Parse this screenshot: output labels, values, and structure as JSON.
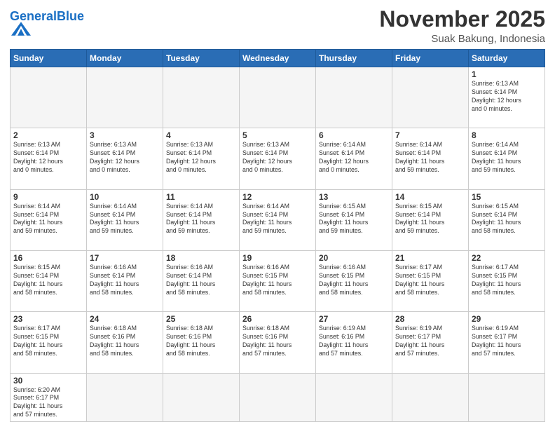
{
  "header": {
    "logo_general": "General",
    "logo_blue": "Blue",
    "month": "November 2025",
    "location": "Suak Bakung, Indonesia"
  },
  "days_of_week": [
    "Sunday",
    "Monday",
    "Tuesday",
    "Wednesday",
    "Thursday",
    "Friday",
    "Saturday"
  ],
  "weeks": [
    [
      {
        "day": "",
        "info": ""
      },
      {
        "day": "",
        "info": ""
      },
      {
        "day": "",
        "info": ""
      },
      {
        "day": "",
        "info": ""
      },
      {
        "day": "",
        "info": ""
      },
      {
        "day": "",
        "info": ""
      },
      {
        "day": "1",
        "info": "Sunrise: 6:13 AM\nSunset: 6:14 PM\nDaylight: 12 hours\nand 0 minutes."
      }
    ],
    [
      {
        "day": "2",
        "info": "Sunrise: 6:13 AM\nSunset: 6:14 PM\nDaylight: 12 hours\nand 0 minutes."
      },
      {
        "day": "3",
        "info": "Sunrise: 6:13 AM\nSunset: 6:14 PM\nDaylight: 12 hours\nand 0 minutes."
      },
      {
        "day": "4",
        "info": "Sunrise: 6:13 AM\nSunset: 6:14 PM\nDaylight: 12 hours\nand 0 minutes."
      },
      {
        "day": "5",
        "info": "Sunrise: 6:13 AM\nSunset: 6:14 PM\nDaylight: 12 hours\nand 0 minutes."
      },
      {
        "day": "6",
        "info": "Sunrise: 6:14 AM\nSunset: 6:14 PM\nDaylight: 12 hours\nand 0 minutes."
      },
      {
        "day": "7",
        "info": "Sunrise: 6:14 AM\nSunset: 6:14 PM\nDaylight: 11 hours\nand 59 minutes."
      },
      {
        "day": "8",
        "info": "Sunrise: 6:14 AM\nSunset: 6:14 PM\nDaylight: 11 hours\nand 59 minutes."
      }
    ],
    [
      {
        "day": "9",
        "info": "Sunrise: 6:14 AM\nSunset: 6:14 PM\nDaylight: 11 hours\nand 59 minutes."
      },
      {
        "day": "10",
        "info": "Sunrise: 6:14 AM\nSunset: 6:14 PM\nDaylight: 11 hours\nand 59 minutes."
      },
      {
        "day": "11",
        "info": "Sunrise: 6:14 AM\nSunset: 6:14 PM\nDaylight: 11 hours\nand 59 minutes."
      },
      {
        "day": "12",
        "info": "Sunrise: 6:14 AM\nSunset: 6:14 PM\nDaylight: 11 hours\nand 59 minutes."
      },
      {
        "day": "13",
        "info": "Sunrise: 6:15 AM\nSunset: 6:14 PM\nDaylight: 11 hours\nand 59 minutes."
      },
      {
        "day": "14",
        "info": "Sunrise: 6:15 AM\nSunset: 6:14 PM\nDaylight: 11 hours\nand 59 minutes."
      },
      {
        "day": "15",
        "info": "Sunrise: 6:15 AM\nSunset: 6:14 PM\nDaylight: 11 hours\nand 58 minutes."
      }
    ],
    [
      {
        "day": "16",
        "info": "Sunrise: 6:15 AM\nSunset: 6:14 PM\nDaylight: 11 hours\nand 58 minutes."
      },
      {
        "day": "17",
        "info": "Sunrise: 6:16 AM\nSunset: 6:14 PM\nDaylight: 11 hours\nand 58 minutes."
      },
      {
        "day": "18",
        "info": "Sunrise: 6:16 AM\nSunset: 6:14 PM\nDaylight: 11 hours\nand 58 minutes."
      },
      {
        "day": "19",
        "info": "Sunrise: 6:16 AM\nSunset: 6:15 PM\nDaylight: 11 hours\nand 58 minutes."
      },
      {
        "day": "20",
        "info": "Sunrise: 6:16 AM\nSunset: 6:15 PM\nDaylight: 11 hours\nand 58 minutes."
      },
      {
        "day": "21",
        "info": "Sunrise: 6:17 AM\nSunset: 6:15 PM\nDaylight: 11 hours\nand 58 minutes."
      },
      {
        "day": "22",
        "info": "Sunrise: 6:17 AM\nSunset: 6:15 PM\nDaylight: 11 hours\nand 58 minutes."
      }
    ],
    [
      {
        "day": "23",
        "info": "Sunrise: 6:17 AM\nSunset: 6:15 PM\nDaylight: 11 hours\nand 58 minutes."
      },
      {
        "day": "24",
        "info": "Sunrise: 6:18 AM\nSunset: 6:16 PM\nDaylight: 11 hours\nand 58 minutes."
      },
      {
        "day": "25",
        "info": "Sunrise: 6:18 AM\nSunset: 6:16 PM\nDaylight: 11 hours\nand 58 minutes."
      },
      {
        "day": "26",
        "info": "Sunrise: 6:18 AM\nSunset: 6:16 PM\nDaylight: 11 hours\nand 57 minutes."
      },
      {
        "day": "27",
        "info": "Sunrise: 6:19 AM\nSunset: 6:16 PM\nDaylight: 11 hours\nand 57 minutes."
      },
      {
        "day": "28",
        "info": "Sunrise: 6:19 AM\nSunset: 6:17 PM\nDaylight: 11 hours\nand 57 minutes."
      },
      {
        "day": "29",
        "info": "Sunrise: 6:19 AM\nSunset: 6:17 PM\nDaylight: 11 hours\nand 57 minutes."
      }
    ],
    [
      {
        "day": "30",
        "info": "Sunrise: 6:20 AM\nSunset: 6:17 PM\nDaylight: 11 hours\nand 57 minutes."
      },
      {
        "day": "",
        "info": ""
      },
      {
        "day": "",
        "info": ""
      },
      {
        "day": "",
        "info": ""
      },
      {
        "day": "",
        "info": ""
      },
      {
        "day": "",
        "info": ""
      },
      {
        "day": "",
        "info": ""
      }
    ]
  ]
}
